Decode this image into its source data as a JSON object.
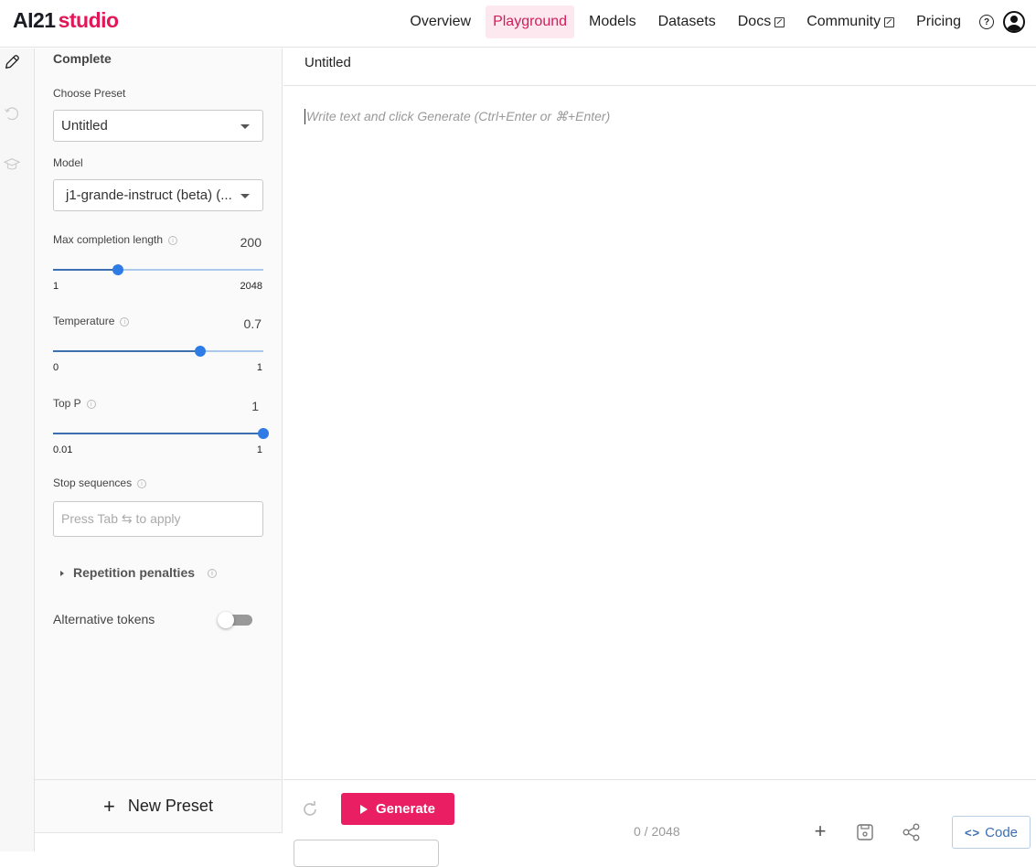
{
  "header": {
    "logo_primary": "AI21",
    "logo_secondary": "studio",
    "nav": [
      {
        "label": "Overview",
        "active": false,
        "external": false
      },
      {
        "label": "Playground",
        "active": true,
        "external": false
      },
      {
        "label": "Models",
        "active": false,
        "external": false
      },
      {
        "label": "Datasets",
        "active": false,
        "external": false
      },
      {
        "label": "Docs",
        "active": false,
        "external": true
      },
      {
        "label": "Community",
        "active": false,
        "external": true
      },
      {
        "label": "Pricing",
        "active": false,
        "external": false
      }
    ],
    "help_icon": "?",
    "accent_color": "#e0185a"
  },
  "rail": {
    "items": [
      {
        "icon": "pencil-icon",
        "active": true
      },
      {
        "icon": "history-icon",
        "active": false
      },
      {
        "icon": "graduation-cap-icon",
        "active": false
      }
    ]
  },
  "sidebar": {
    "section_title": "Complete",
    "preset": {
      "label": "Choose Preset",
      "value": "Untitled"
    },
    "model": {
      "label": "Model",
      "value": "j1-grande-instruct (beta) (..."
    },
    "max_length": {
      "label": "Max completion length",
      "value": "200",
      "min": "1",
      "max": "2048",
      "fraction": 0.31
    },
    "temperature": {
      "label": "Temperature",
      "value": "0.7",
      "min": "0",
      "max": "1",
      "fraction": 0.7
    },
    "top_p": {
      "label": "Top P",
      "value": "1",
      "min": "0.01",
      "max": "1",
      "fraction": 1.0
    },
    "stop_sequences": {
      "label": "Stop sequences",
      "placeholder": "Press Tab ⇆ to apply"
    },
    "repetition_penalties": {
      "label": "Repetition penalties",
      "expanded": false
    },
    "alternative_tokens": {
      "label": "Alternative tokens",
      "enabled": false
    },
    "new_preset_label": "New Preset",
    "new_preset_icon": "+"
  },
  "main": {
    "title": "Untitled",
    "editor_placeholder": "Write text and click Generate (Ctrl+Enter or ⌘+Enter)",
    "generate_label": "Generate",
    "counter": "0 / 2048",
    "code_label": "Code",
    "code_icon": "<>",
    "add_icon": "+"
  }
}
